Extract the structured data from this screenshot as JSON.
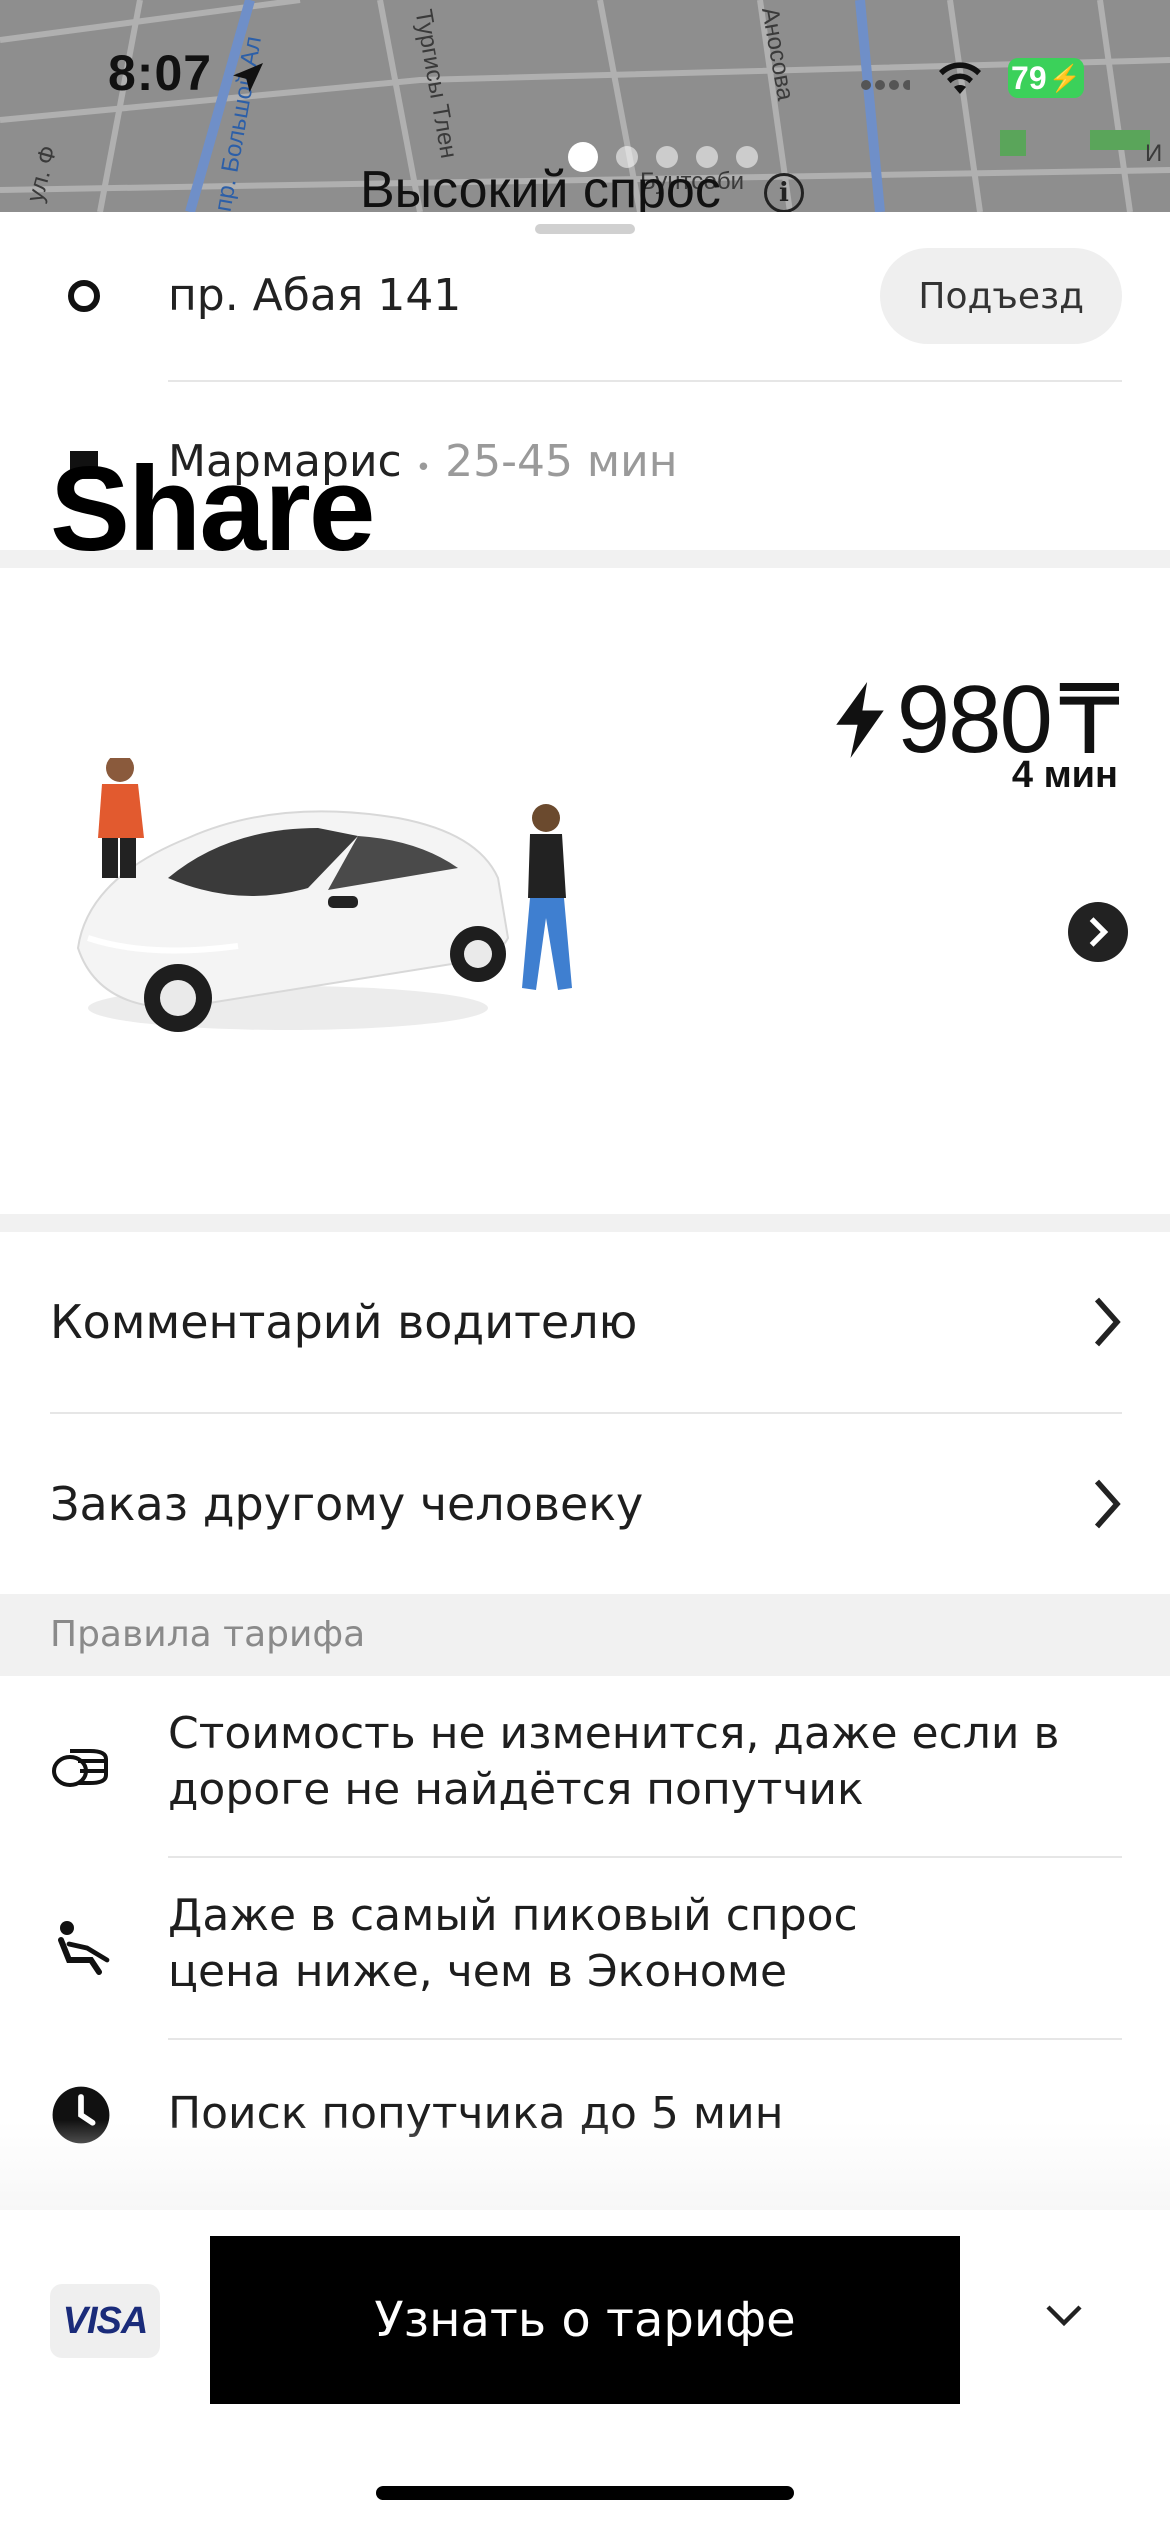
{
  "status_bar": {
    "time": "8:07",
    "battery": "79"
  },
  "map": {
    "street_labels": [
      "ул. Ф",
      "пр. Большой Ал",
      "Тургисы Тлен",
      "Аносова",
      "Бунтсоби",
      "И"
    ],
    "demand_label": "Высокий спрос",
    "page_dots": 5
  },
  "route": {
    "pickup": "пр. Абая 141",
    "entrance_button": "Подъезд",
    "destination": "Мармарис",
    "separator": "•",
    "duration": "25-45 мин"
  },
  "tariff": {
    "name": "Share",
    "price": "980",
    "currency": "₸",
    "eta": "4 мин"
  },
  "menu": {
    "comment": "Комментарий водителю",
    "other_person": "Заказ другому человеку"
  },
  "rules": {
    "header": "Правила тарифа",
    "items": [
      {
        "icon": "coins-icon",
        "line1": "Стоимость не изменится, даже если в",
        "line2": "дороге не найдётся попутчик"
      },
      {
        "icon": "seat-passenger-icon",
        "line1": "Даже в самый пиковый спрос",
        "line2": "цена ниже, чем в Экономе"
      },
      {
        "icon": "clock-icon",
        "line1": "Поиск попутчика до 5 мин"
      }
    ]
  },
  "footer": {
    "payment": "VISA",
    "main_button": "Узнать о тарифе"
  },
  "colors": {
    "battery": "#3bd15a",
    "map": "#8e8e8e",
    "button": "#000000"
  }
}
